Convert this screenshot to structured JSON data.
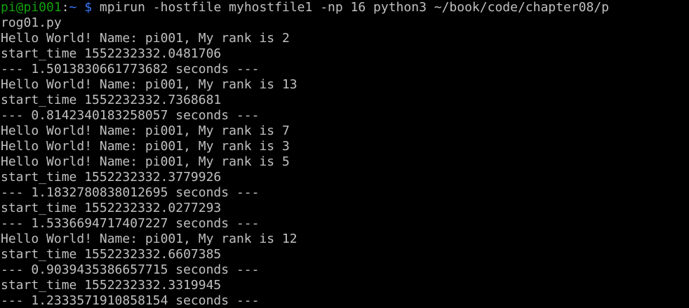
{
  "prompt": {
    "user_host": "pi@pi001",
    "separator": ":",
    "cwd": "~",
    "symbol": "$",
    "command": "mpirun -hostfile myhostfile1 -np 16 python3 ~/book/code/chapter08/p"
  },
  "output": [
    "rog01.py",
    "Hello World! Name: pi001, My rank is 2",
    "start_time 1552232332.0481706",
    "--- 1.5013830661773682 seconds ---",
    "Hello World! Name: pi001, My rank is 13",
    "start_time 1552232332.7368681",
    "--- 0.8142340183258057 seconds ---",
    "Hello World! Name: pi001, My rank is 7",
    "Hello World! Name: pi001, My rank is 3",
    "Hello World! Name: pi001, My rank is 5",
    "start_time 1552232332.3779926",
    "--- 1.1832780838012695 seconds ---",
    "start_time 1552232332.0277293",
    "--- 1.5336694717407227 seconds ---",
    "Hello World! Name: pi001, My rank is 12",
    "start_time 1552232332.6607385",
    "--- 0.9039435386657715 seconds ---",
    "start_time 1552232332.3319945",
    "--- 1.2333571910858154 seconds ---"
  ],
  "colors": {
    "background": "#000000",
    "text": "#c0c0c0",
    "prompt_user": "#13a10e",
    "prompt_path": "#3b78ff"
  }
}
